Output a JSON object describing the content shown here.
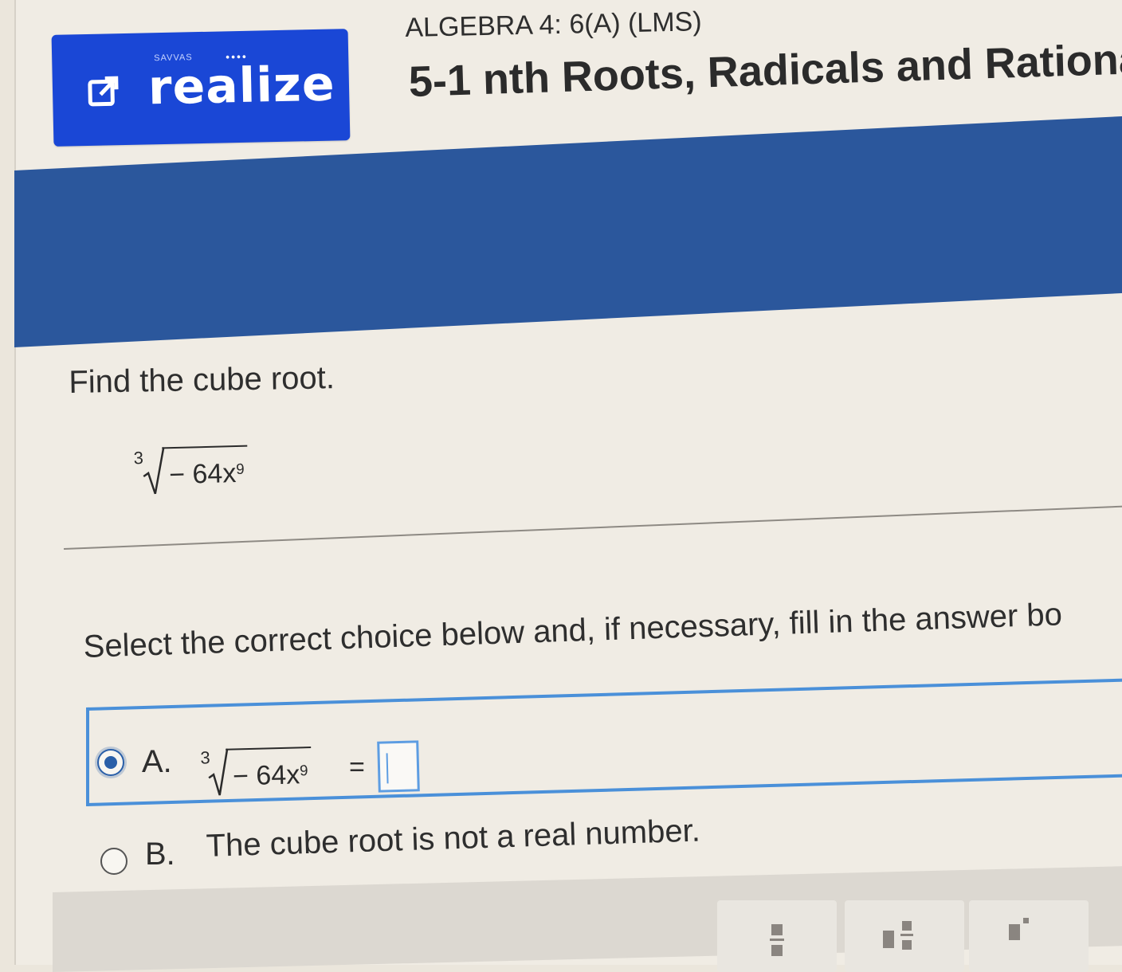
{
  "header": {
    "logo_small_text": "SAVVAS",
    "logo_text": "realize",
    "course_label": "ALGEBRA 4: 6(A) (LMS)",
    "lesson_title": "5-1 nth Roots, Radicals and Rationa"
  },
  "question": {
    "prompt": "Find the cube root.",
    "expression": {
      "index": "3",
      "radicand": "− 64x",
      "exponent": "9"
    }
  },
  "instruction": "Select the correct choice below and, if necessary, fill in the answer bo",
  "choices": {
    "a": {
      "letter": "A.",
      "selected": true,
      "index": "3",
      "radicand": "− 64x",
      "exponent": "9",
      "equals": "=",
      "answer_value": ""
    },
    "b": {
      "letter": "B.",
      "selected": false,
      "text": "The cube root is not a real number."
    }
  },
  "toolbar": {
    "tools": [
      "fraction-icon",
      "mixed-number-icon",
      "exponent-icon"
    ]
  },
  "colors": {
    "brand_blue": "#1a47d6",
    "band_blue": "#2b579c",
    "selection_blue": "#4a90d9"
  }
}
